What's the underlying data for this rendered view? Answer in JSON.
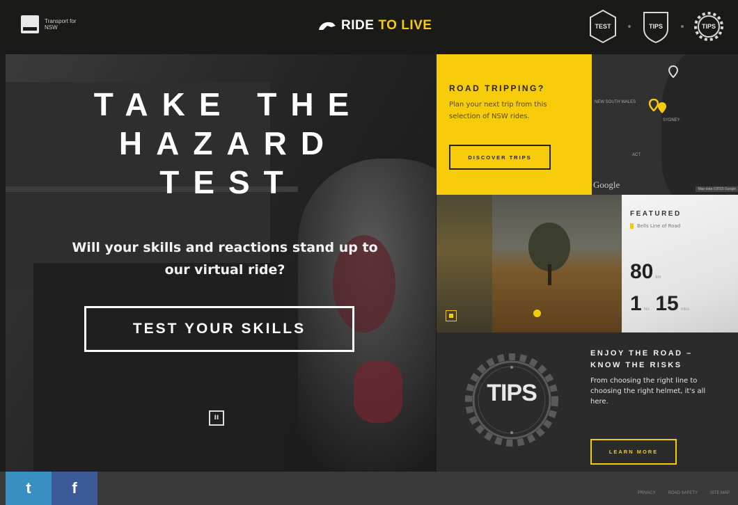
{
  "header": {
    "org_name": "Transport for NSW",
    "brand_part1": "RIDE",
    "brand_part2": "TO LIVE",
    "nav": [
      {
        "label": "TEST",
        "icon": "hexagon-badge-icon"
      },
      {
        "label": "TIPS",
        "icon": "shield-badge-icon"
      },
      {
        "label": "TIPS",
        "icon": "gear-badge-icon"
      }
    ]
  },
  "hero": {
    "title_lines": [
      "TAKE THE",
      "HAZARD",
      "TEST"
    ],
    "subtitle": "Will your skills and reactions stand up to our virtual ride?",
    "cta": "TEST YOUR SKILLS",
    "pause_label": "II"
  },
  "road_trip": {
    "heading": "ROAD TRIPPING?",
    "text": "Plan your next trip from this selection of NSW rides.",
    "button": "DISCOVER TRIPS"
  },
  "map": {
    "region_label": "NEW SOUTH WALES",
    "city_label": "SYDNEY",
    "act_label": "ACT",
    "provider": "Google",
    "attribution": "Map data ©2015 Google"
  },
  "featured": {
    "heading": "FEATURED",
    "road_name": "Bells Line of Road",
    "distance_value": "80",
    "distance_unit": "km",
    "duration_hours": "1",
    "hours_unit": "hrs",
    "duration_minutes": "15",
    "minutes_unit": "mins"
  },
  "tips": {
    "badge_word": "TIPS",
    "heading": "ENJOY THE ROAD – KNOW THE RISKS",
    "text": "From choosing the right line to choosing the right helmet, it's all here.",
    "button": "LEARN MORE"
  },
  "footer": {
    "twitter_icon": "t",
    "facebook_icon": "f",
    "links": [
      "PRIVACY",
      "ROAD SAFETY",
      "SITE MAP"
    ]
  },
  "colors": {
    "accent_yellow": "#f5cb0a",
    "twitter_blue": "#3a8fc2",
    "facebook_blue": "#3c5a97"
  }
}
